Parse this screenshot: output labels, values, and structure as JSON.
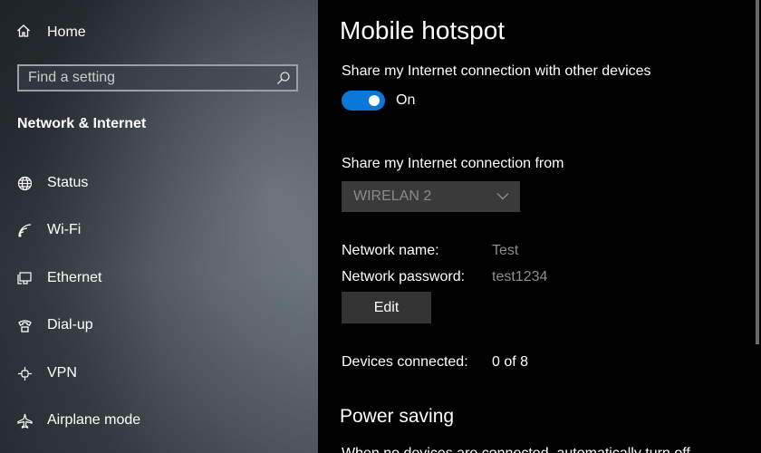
{
  "sidebar": {
    "home_label": "Home",
    "search_placeholder": "Find a setting",
    "section_title": "Network & Internet",
    "items": [
      {
        "label": "Status",
        "icon": "globe-icon"
      },
      {
        "label": "Wi-Fi",
        "icon": "wifi-icon"
      },
      {
        "label": "Ethernet",
        "icon": "ethernet-icon"
      },
      {
        "label": "Dial-up",
        "icon": "dialup-icon"
      },
      {
        "label": "VPN",
        "icon": "vpn-icon"
      },
      {
        "label": "Airplane mode",
        "icon": "airplane-icon"
      }
    ]
  },
  "main": {
    "title": "Mobile hotspot",
    "share_label": "Share my Internet connection with other devices",
    "toggle_state": "On",
    "share_from_label": "Share my Internet connection from",
    "share_from_value": "WIRELAN 2",
    "network_name_label": "Network name:",
    "network_name_value": "Test",
    "network_password_label": "Network password:",
    "network_password_value": "test1234",
    "edit_label": "Edit",
    "devices_label": "Devices connected:",
    "devices_value": "0 of 8",
    "power_saving_title": "Power saving",
    "power_saving_text": "When no devices are connected, automatically turn off"
  },
  "colors": {
    "accent": "#0a78d7",
    "background": "#000000",
    "muted_text": "#8e8e8e"
  }
}
